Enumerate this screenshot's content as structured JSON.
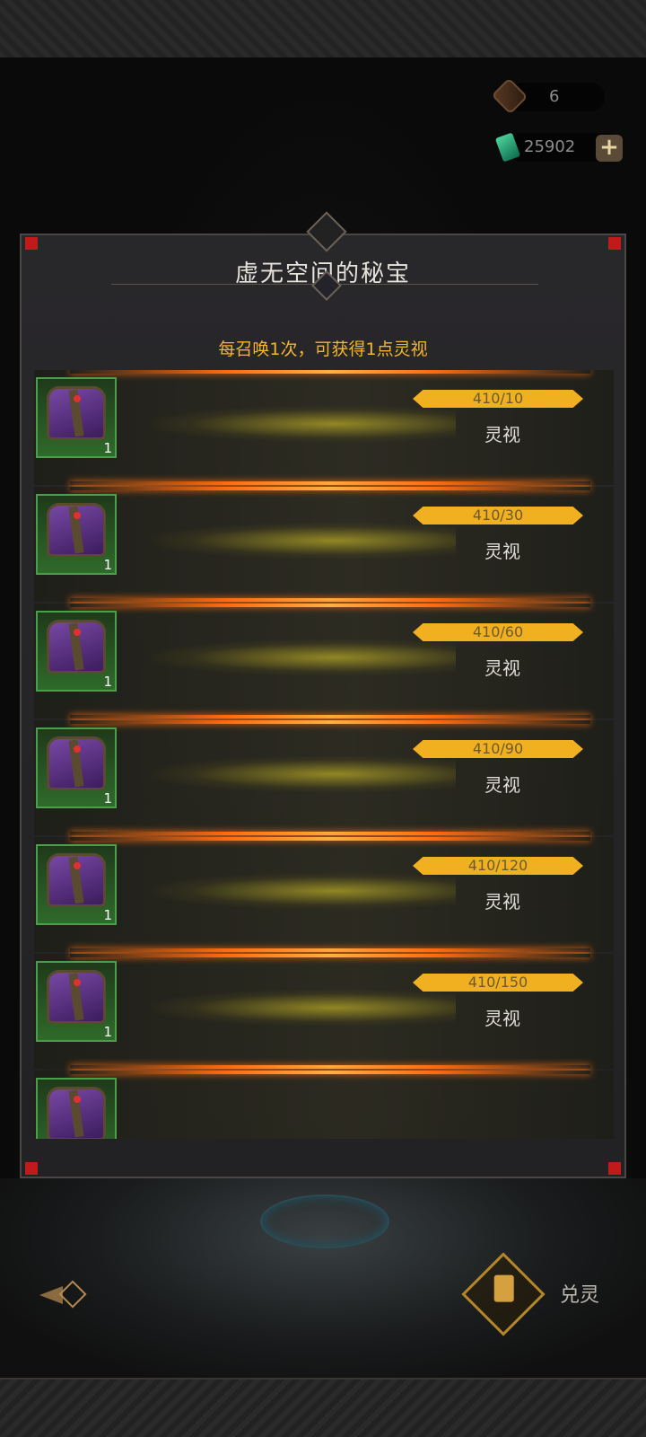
{
  "currencies": [
    {
      "icon": "scroll-icon",
      "value": "6"
    },
    {
      "icon": "green-gem-icon",
      "value": "25902"
    }
  ],
  "panel": {
    "title": "虚无空间的秘宝",
    "subtitle": "每召唤1次，可获得1点灵视"
  },
  "rewards": [
    {
      "item_icon": "purple-chest-icon",
      "count": "1",
      "progress_text": "410/10",
      "reward_label": "灵视"
    },
    {
      "item_icon": "purple-chest-icon",
      "count": "1",
      "progress_text": "410/30",
      "reward_label": "灵视"
    },
    {
      "item_icon": "purple-chest-icon",
      "count": "1",
      "progress_text": "410/60",
      "reward_label": "灵视"
    },
    {
      "item_icon": "purple-chest-icon",
      "count": "1",
      "progress_text": "410/90",
      "reward_label": "灵视"
    },
    {
      "item_icon": "purple-chest-icon",
      "count": "1",
      "progress_text": "410/120",
      "reward_label": "灵视"
    },
    {
      "item_icon": "purple-chest-icon",
      "count": "1",
      "progress_text": "410/150",
      "reward_label": "灵视"
    }
  ],
  "bottom_nav": {
    "exchange_label": "兑灵"
  },
  "colors": {
    "accent_gold": "#f5b52c",
    "progress_bar": "#f0b020",
    "glow_orange": "#ff6a10",
    "item_frame_green": "#4aa04a"
  }
}
